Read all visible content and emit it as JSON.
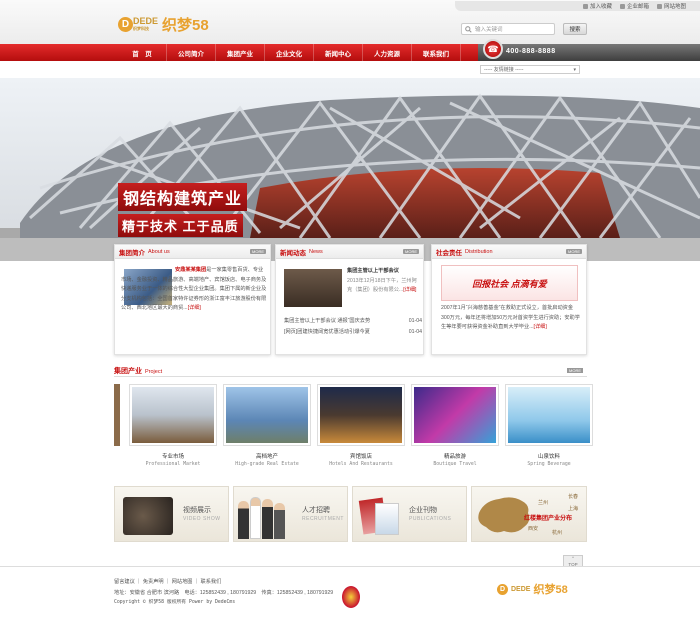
{
  "toplinks": [
    "加入收藏",
    "企业邮箱",
    "网站地图"
  ],
  "logo": {
    "brand": "DEDE",
    "sub": "织梦科技",
    "name": "织梦58"
  },
  "search": {
    "placeholder": "输入关键词",
    "button": "搜索"
  },
  "nav": [
    "首　页",
    "公司简介",
    "集团产业",
    "企业文化",
    "新闻中心",
    "人力资源",
    "联系我们"
  ],
  "phone": "400-888-8888",
  "friend_links": {
    "selected": "----- 友情链接 -----"
  },
  "banner": {
    "slogan1": "钢结构建筑产业",
    "slogan2": "精于技术 工于品质"
  },
  "about": {
    "title": "集团简介",
    "en": "About us",
    "more": "MORE",
    "company": "安鼎某某集团",
    "text": "是一家集零售百货、专业市场、金融投资、精品旅游、高端地产、宾馆饭店、电子商务及快递服务业于一体的综合性大型企业集团。集团下属的新企业及分支机构包括：全国首家特许证券形的浙江富丰江旅游股份有限公司、西北地区最大的商贸...",
    "detail": "[详细]"
  },
  "news": {
    "title": "新闻动态",
    "en": "News",
    "more": "MORE",
    "headline": "集团主管以上干部会议",
    "summary": "2013年12月18日下午，兰州阿克（集团）股份有限公...",
    "detail": "[详细]",
    "items": [
      {
        "text": "集团主管以上干部会议 通报“国庆去势",
        "date": "01-04"
      },
      {
        "text": "[网页]团建快捷阔宽优惠活动引爆今夏",
        "date": "01-04"
      }
    ]
  },
  "social": {
    "title": "社会责任",
    "en": "Distribution",
    "more": "MORE",
    "banner_text": "回报社会 点滴有爱",
    "text": "2007年1月“兴海慈善基金”在救助正式设立，首批启动资金300万元，每年还将增加50万元对首资学生进行资助；安助学生等年要可获得资金补助直到大学毕业...",
    "detail": "[详细]"
  },
  "project": {
    "title": "集团产业",
    "en": "Project",
    "more": "MORE",
    "items": [
      {
        "name": "专业市场",
        "en": "Professional Market"
      },
      {
        "name": "高档地产",
        "en": "High-grade Real Estate"
      },
      {
        "name": "宾馆饭店",
        "en": "Hotels And Restaurants"
      },
      {
        "name": "精品旅游",
        "en": "Boutique Travel"
      },
      {
        "name": "山泉饮料",
        "en": "Spring Beverage"
      }
    ]
  },
  "boxes": [
    {
      "title": "视频展示",
      "sub": "VIDEO SHOW"
    },
    {
      "title": "人才招聘",
      "sub": "RECRUITMENT"
    },
    {
      "title": "企业刊物",
      "sub": "PUBLICATIONS"
    },
    {
      "title": "红楼集团产业分布",
      "cities": [
        "兰州",
        "长春",
        "上海",
        "西安",
        "杭州"
      ]
    }
  ],
  "footer": {
    "links": [
      "留言建议",
      "免责声明",
      "网站地图",
      "联系我们"
    ],
    "address": "地址：安徽省 合肥市 滨河路　电话：125852439 , 180791929　传真：125852439 , 180791929",
    "copyright": "Copyright © 织梦58 版权所有 Power by DedeCms",
    "top": "TOP"
  }
}
